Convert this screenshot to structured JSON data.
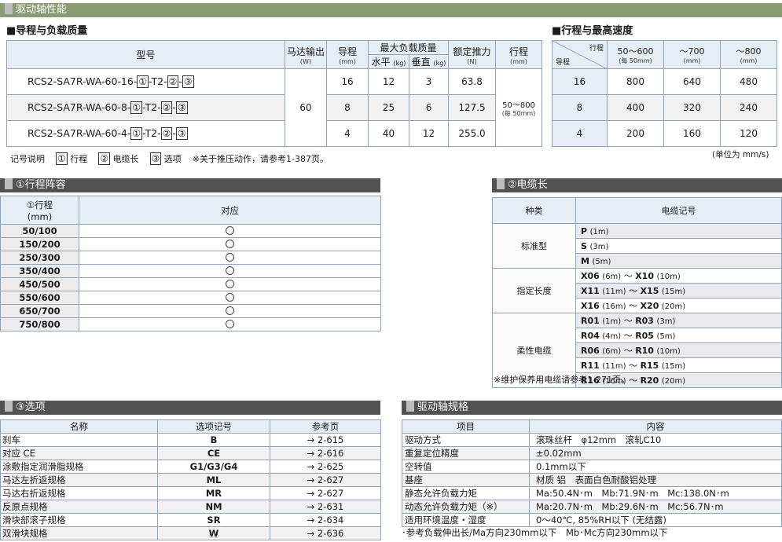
{
  "top_bar": {
    "title": "驱动轴性能"
  },
  "perf": {
    "heading": "■导程与负载质量",
    "headers": {
      "model": "型号",
      "motor": "马达输出",
      "motor_unit": "(W)",
      "lead": "导程",
      "lead_unit": "(mm)",
      "max_load": "最大负载质量",
      "horizontal": "水平",
      "horizontal_unit": "(kg)",
      "vertical": "垂直",
      "vertical_unit": "(kg)",
      "thrust": "额定推力",
      "thrust_unit": "(N)",
      "stroke": "行程",
      "stroke_unit": "(mm)"
    },
    "motor_value": "60",
    "stroke_value": "50～800",
    "stroke_sub": "(每 50mm)",
    "rows": [
      {
        "model": "RCS2-SA7R-WA-60-16-",
        "box1": "①",
        "mid": "-T2-",
        "box2": "②",
        "dash": "-",
        "box3": "③",
        "lead": "16",
        "horizontal": "12",
        "vertical": "3",
        "thrust": "63.8"
      },
      {
        "model": "RCS2-SA7R-WA-60-8-",
        "box1": "①",
        "mid": "-T2-",
        "box2": "②",
        "dash": "-",
        "box3": "③",
        "lead": "8",
        "horizontal": "25",
        "vertical": "6",
        "thrust": "127.5"
      },
      {
        "model": "RCS2-SA7R-WA-60-4-",
        "box1": "①",
        "mid": "-T2-",
        "box2": "②",
        "dash": "-",
        "box3": "③",
        "lead": "4",
        "horizontal": "40",
        "vertical": "12",
        "thrust": "255.0"
      }
    ],
    "legend": {
      "title": "记号说明",
      "items": [
        {
          "box": "①",
          "label": "行程"
        },
        {
          "box": "②",
          "label": "电缆长"
        },
        {
          "box": "③",
          "label": "选项"
        }
      ],
      "note": "※关于推压动作，请参考1-387页。"
    }
  },
  "speed": {
    "heading": "■行程与最高速度",
    "corner_top": "行程",
    "corner_bottom": "导程",
    "columns": [
      {
        "label": "50～600",
        "sub": "(每 50mm)"
      },
      {
        "label": "～700",
        "sub": "(mm)"
      },
      {
        "label": "～800",
        "sub": "(mm)"
      }
    ],
    "rows": [
      {
        "lead": "16",
        "values": [
          "800",
          "640",
          "480"
        ]
      },
      {
        "lead": "8",
        "values": [
          "400",
          "320",
          "240"
        ]
      },
      {
        "lead": "4",
        "values": [
          "200",
          "160",
          "120"
        ]
      }
    ],
    "unit_note": "(单位为 mm/s)"
  },
  "stroke_list": {
    "title": "①行程阵容",
    "header_stroke": "①行程",
    "header_stroke_unit": "(mm)",
    "header_support": "对应",
    "rows": [
      "50/100",
      "150/200",
      "250/300",
      "350/400",
      "450/500",
      "550/600",
      "650/700",
      "750/800"
    ]
  },
  "cable": {
    "title": "②电缆长",
    "header_type": "种类",
    "header_code": "电缆记号",
    "groups": [
      {
        "type": "标准型",
        "items": [
          {
            "a": "P",
            "al": "(1m)",
            "b": "",
            "bl": ""
          },
          {
            "a": "S",
            "al": "(3m)",
            "b": "",
            "bl": ""
          },
          {
            "a": "M",
            "al": "(5m)",
            "b": "",
            "bl": ""
          }
        ]
      },
      {
        "type": "指定长度",
        "items": [
          {
            "a": "X06",
            "al": "(6m)",
            "b": "X10",
            "bl": "(10m)"
          },
          {
            "a": "X11",
            "al": "(11m)",
            "b": "X15",
            "bl": "(15m)"
          },
          {
            "a": "X16",
            "al": "(16m)",
            "b": "X20",
            "bl": "(20m)"
          }
        ]
      },
      {
        "type": "柔性电缆",
        "items": [
          {
            "a": "R01",
            "al": "(1m)",
            "b": "R03",
            "bl": "(3m)"
          },
          {
            "a": "R04",
            "al": "(4m)",
            "b": "R05",
            "bl": "(5m)"
          },
          {
            "a": "R06",
            "al": "(6m)",
            "b": "R10",
            "bl": "(10m)"
          },
          {
            "a": "R11",
            "al": "(11m)",
            "b": "R15",
            "bl": "(15m)"
          },
          {
            "a": "R16",
            "al": "(16m)",
            "b": "R20",
            "bl": "(20m)"
          }
        ]
      }
    ],
    "tilde": "～",
    "note": "※维护保养用电缆请参考1-271页。"
  },
  "options": {
    "title": "③选项",
    "headers": {
      "name": "名称",
      "code": "选项记号",
      "page": "参考页"
    },
    "rows": [
      {
        "name": "刹车",
        "code": "B",
        "page": "→ 2-615"
      },
      {
        "name": "对应 CE",
        "code": "CE",
        "page": "→ 2-616"
      },
      {
        "name": "涂敷指定润滑脂规格",
        "code": "G1/G3/G4",
        "page": "→ 2-625"
      },
      {
        "name": "马达左折返规格",
        "code": "ML",
        "page": "→ 2-627"
      },
      {
        "name": "马达右折返规格",
        "code": "MR",
        "page": "→ 2-627"
      },
      {
        "name": "反原点规格",
        "code": "NM",
        "page": "→ 2-631"
      },
      {
        "name": "滑块部滚子规格",
        "code": "SR",
        "page": "→ 2-634"
      },
      {
        "name": "双滑块规格",
        "code": "W",
        "page": "→ 2-636"
      }
    ]
  },
  "spec": {
    "title": "驱动轴规格",
    "headers": {
      "item": "项目",
      "content": "内容"
    },
    "rows": [
      {
        "item": "驱动方式",
        "value": "滚珠丝杆　φ12mm　滚轧C10"
      },
      {
        "item": "重复定位精度",
        "value": "±0.02mm"
      },
      {
        "item": "空转值",
        "value": "0.1mm以下"
      },
      {
        "item": "基座",
        "value": "材质 铝　表面白色耐酸铝处理"
      },
      {
        "item": "静态允许负载力矩",
        "value": "Ma:50.4N･m　Mb:71.9N･m　Mc:138.0N･m"
      },
      {
        "item": "动态允许负载力矩（※）",
        "value": "Ma:20.7N･m　Mb:29.6N･m　Mc:56.7N･m"
      },
      {
        "item": "适用环境温度・湿度",
        "value": "0～40℃, 85%RH以下 (无结露)"
      }
    ],
    "note": "･参考负载伸出长/Ma方向230mm以下　Mb･Mc方向230mm以下"
  }
}
